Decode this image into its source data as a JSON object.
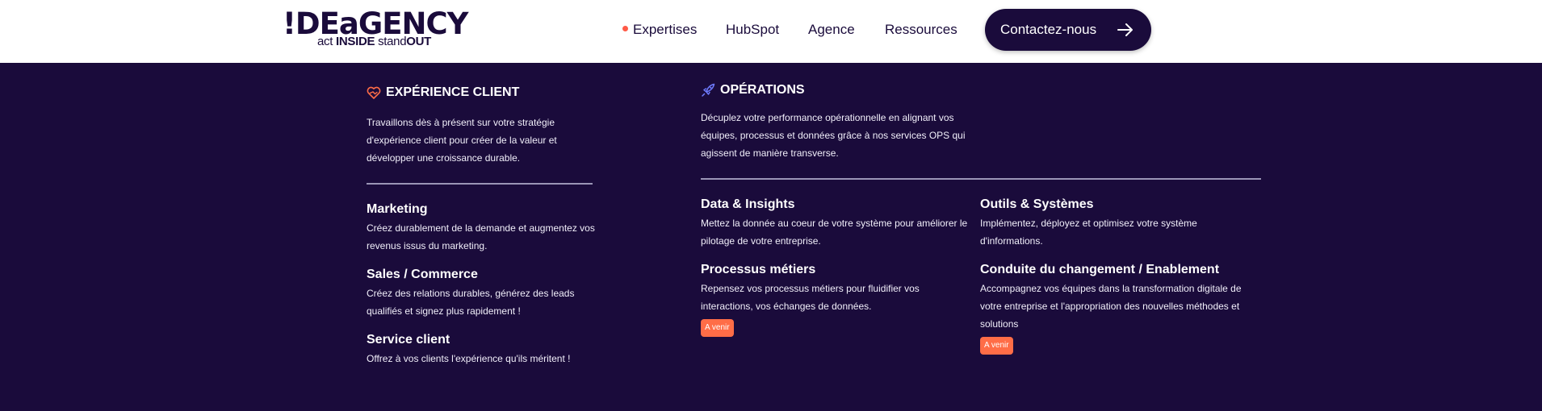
{
  "header": {
    "logo": {
      "main": "!DEaGENCY",
      "sub_prefix": "act ",
      "sub_bold1": "INSIDE",
      "sub_mid": " stand",
      "sub_bold2": "OUT"
    },
    "nav": [
      "Expertises",
      "HubSpot",
      "Agence",
      "Ressources"
    ],
    "cta_label": "Contactez-nous"
  },
  "experience": {
    "title": "EXPÉRIENCE CLIENT",
    "description": "Travaillons dès à présent sur votre stratégie d'expérience client pour créer de la valeur et développer une croissance durable.",
    "items": [
      {
        "title": "Marketing",
        "desc": "Créez durablement de la demande et augmentez vos revenus issus du marketing."
      },
      {
        "title": "Sales / Commerce",
        "desc": "Créez des relations durables, générez des leads qualifiés et signez plus rapidement !"
      },
      {
        "title": "Service client",
        "desc": "Offrez à vos clients l'expérience qu'ils méritent !"
      }
    ]
  },
  "operations": {
    "title": "OPÉRATIONS",
    "description": "Décuplez votre performance opérationnelle en alignant vos équipes, processus et données grâce à nos services OPS qui agissent de manière transverse.",
    "items": [
      {
        "title": "Data & Insights",
        "desc": "Mettez la donnée au coeur de votre système pour améliorer le pilotage de votre entreprise."
      },
      {
        "title": "Outils & Systèmes",
        "desc": "Implémentez, déployez et optimisez votre système d'informations."
      },
      {
        "title": "Processus métiers",
        "desc": "Repensez vos processus métiers pour fluidifier vos interactions, vos échanges de données.",
        "badge": "A venir"
      },
      {
        "title": "Conduite du changement / Enablement",
        "desc": "Accompagnez vos équipes dans la transformation digitale de votre entreprise et l'appropriation des nouvelles méthodes et solutions",
        "badge": "A venir"
      }
    ]
  },
  "colors": {
    "navy": "#1a0b3b",
    "accent": "#ff6d47",
    "white": "#ffffff"
  },
  "icons": {
    "experience": "heart-handshake-icon",
    "operations": "rocket-icon",
    "cta": "arrow-right-icon"
  }
}
